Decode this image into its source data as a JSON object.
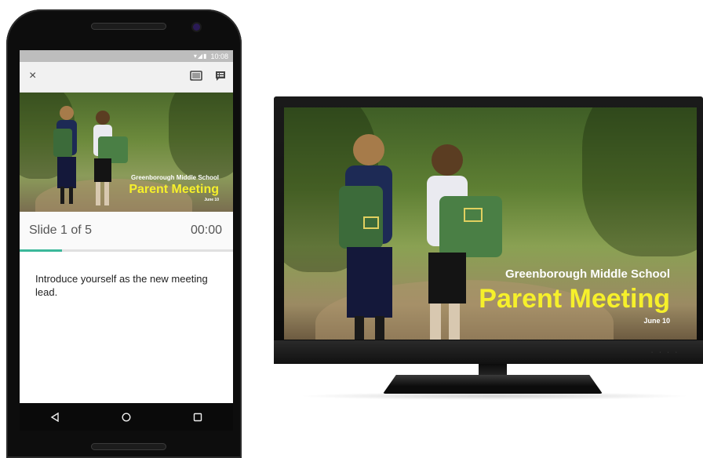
{
  "status_bar": {
    "time": "10:08",
    "icons": "▾◢▮"
  },
  "app_bar": {
    "close_icon": "×",
    "cast_icon": "cast-icon",
    "notes_icon": "speaker-notes-icon"
  },
  "slide": {
    "school": "Greenborough Middle School",
    "title": "Parent Meeting",
    "date": "June 10"
  },
  "slide_status": {
    "label": "Slide 1 of 5",
    "timer": "00:00",
    "progress": 0.2
  },
  "speaker_notes": "Introduce yourself as the new meeting lead.",
  "nav": {
    "back": "◁",
    "home": "○",
    "recents": "□"
  },
  "colors": {
    "accent": "#3bb89a",
    "title_yellow": "#f6f02b"
  }
}
